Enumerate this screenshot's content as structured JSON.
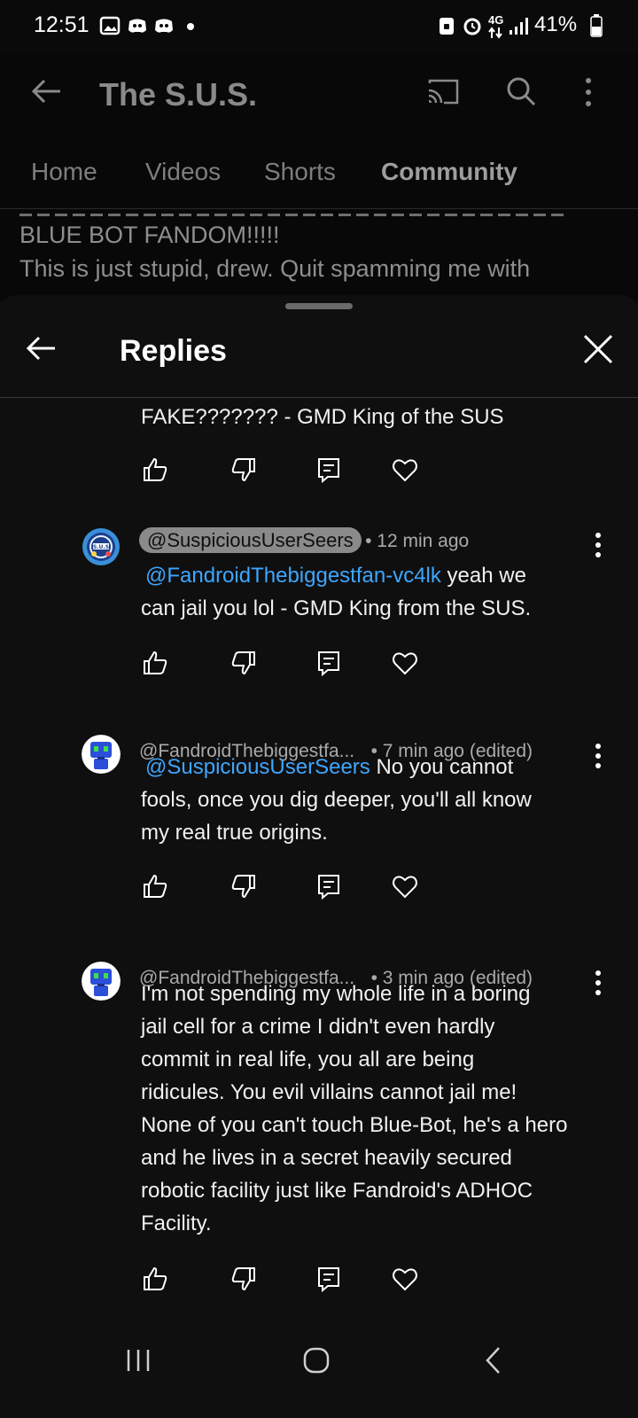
{
  "status_bar": {
    "time": "12:51",
    "network": "4G",
    "battery": "41%"
  },
  "background_page": {
    "channel_title": "The S.U.S.",
    "tabs": [
      "Home",
      "Videos",
      "Shorts",
      "Community"
    ],
    "active_tab": "Community",
    "post_lines": [
      "BLUE BOT FANDOM!!!!!",
      "This is just stupid, drew. Quit spamming me with"
    ]
  },
  "replies_sheet": {
    "title": "Replies",
    "comments": [
      {
        "lines": [
          "FAKE??????? - GMD King of the SUS"
        ]
      },
      {
        "author": "@SuspiciousUserSeers",
        "time": "• 12 min ago",
        "mention": "@FandroidThebiggestfan-vc4lk",
        "text_after_mention": "yeah we",
        "lines": [
          "can jail you lol - GMD King from the SUS."
        ]
      },
      {
        "author": "@FandroidThebiggestfa...",
        "time": "• 7 min ago (edited)",
        "mention": "@SuspiciousUserSeers",
        "text_after_mention": "No you cannot",
        "lines": [
          "fools, once you dig deeper, you'll all know",
          "my real true origins."
        ]
      },
      {
        "author": "@FandroidThebiggestfa...",
        "time": "• 3 min ago (edited)",
        "lines": [
          "I'm not spending my whole life in a boring",
          "jail cell for a crime I didn't even hardly",
          "commit in real life, you all are being",
          "ridicules. You evil villains cannot jail me!",
          "None of you can't touch Blue-Bot, he's a hero",
          "and he lives in a secret heavily secured",
          "robotic facility just like Fandroid's ADHOC",
          "Facility."
        ]
      }
    ]
  },
  "icons": {
    "like": "thumbs-up-icon",
    "dislike": "thumbs-down-icon",
    "reply": "reply-icon",
    "heart": "heart-icon",
    "more": "more-vert-icon",
    "back": "back-arrow-icon",
    "close": "close-icon",
    "cast": "cast-icon",
    "search": "search-icon"
  },
  "colors": {
    "background": "#0f0f0f",
    "mention": "#3ea6ff",
    "secondary_text": "#aaaaaa",
    "author_chip": "#8a8a8a"
  }
}
